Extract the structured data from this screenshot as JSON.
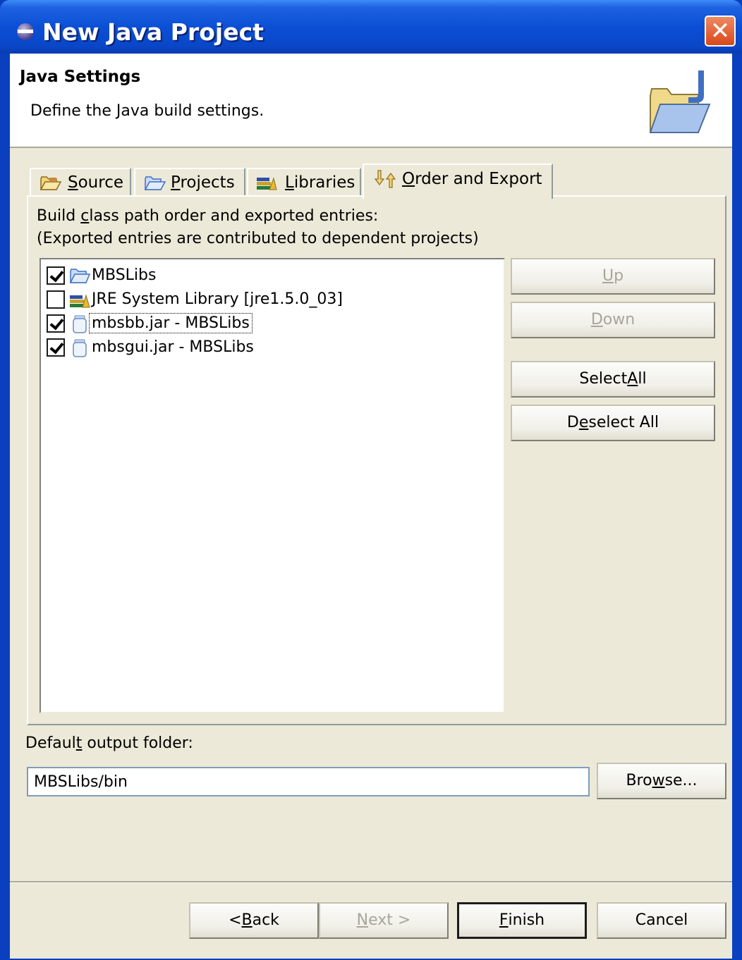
{
  "window": {
    "title": "New Java Project",
    "close_label": "✕"
  },
  "header": {
    "title": "Java Settings",
    "description": "Define the Java build settings."
  },
  "tabs": [
    {
      "label_pre": "",
      "label_mnemonic": "S",
      "label_post": "ource",
      "icon": "source-folder-icon",
      "active": false
    },
    {
      "label_pre": "",
      "label_mnemonic": "P",
      "label_post": "rojects",
      "icon": "projects-folder-icon",
      "active": false
    },
    {
      "label_pre": "",
      "label_mnemonic": "L",
      "label_post": "ibraries",
      "icon": "libraries-icon",
      "active": false
    },
    {
      "label_pre": "",
      "label_mnemonic": "O",
      "label_post": "rder and Export",
      "icon": "order-export-icon",
      "active": true
    }
  ],
  "panel": {
    "line1_pre": "Build ",
    "line1_mnemonic": "c",
    "line1_post": "lass path order and exported entries:",
    "line2": "(Exported entries are contributed to dependent projects)"
  },
  "entries": [
    {
      "label": "MBSLibs",
      "checked": true,
      "icon": "project-folder-icon"
    },
    {
      "label": "JRE System Library [jre1.5.0_03]",
      "checked": false,
      "icon": "library-icon"
    },
    {
      "label": "mbsbb.jar - MBSLibs",
      "checked": true,
      "icon": "jar-icon",
      "focused": true
    },
    {
      "label": "mbsgui.jar - MBSLibs",
      "checked": true,
      "icon": "jar-icon"
    }
  ],
  "side_buttons": {
    "up": {
      "pre": "",
      "mnemonic": "U",
      "post": "p",
      "enabled": false
    },
    "down": {
      "pre": "",
      "mnemonic": "D",
      "post": "own",
      "enabled": false
    },
    "select_all": {
      "pre": "Select ",
      "mnemonic": "A",
      "post": "ll",
      "enabled": true
    },
    "deselect_all": {
      "pre": "D",
      "mnemonic": "e",
      "post": "select All",
      "enabled": true
    }
  },
  "output": {
    "label_pre": "Defaul",
    "label_mnemonic": "t",
    "label_post": " output folder:",
    "value": "MBSLibs/bin",
    "browse": {
      "pre": "Bro",
      "mnemonic": "w",
      "post": "se..."
    }
  },
  "footer": {
    "back": {
      "pre": "< ",
      "mnemonic": "B",
      "post": "ack",
      "enabled": true
    },
    "next": {
      "pre": "",
      "mnemonic": "N",
      "post": "ext >",
      "enabled": false
    },
    "finish": {
      "pre": "",
      "mnemonic": "F",
      "post": "inish",
      "enabled": true
    },
    "cancel": {
      "label": "Cancel",
      "enabled": true
    }
  },
  "colors": {
    "titlebar": "#0b4fd6",
    "dialog_bg": "#ece9d8",
    "close_button": "#d9481c",
    "disabled_text": "#a8a69b"
  }
}
